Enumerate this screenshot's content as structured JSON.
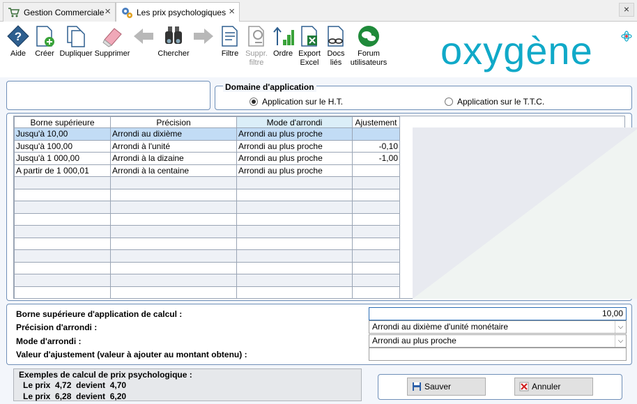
{
  "tabs": [
    {
      "label": "Gestion Commerciale",
      "icon": "cart-icon",
      "active": false
    },
    {
      "label": "Les prix psychologiques",
      "icon": "gears-icon",
      "active": true
    }
  ],
  "toolbar": {
    "aide": "Aide",
    "creer": "Créer",
    "dupliquer": "Dupliquer",
    "supprimer": "Supprimer",
    "chercher": "Chercher",
    "filtre": "Filtre",
    "suppr_filtre": [
      "Suppr.",
      "filtre"
    ],
    "ordre": "Ordre",
    "export_excel": [
      "Export",
      "Excel"
    ],
    "docs_lies": [
      "Docs",
      "liés"
    ],
    "forum": [
      "Forum",
      "utilisateurs"
    ]
  },
  "logo": "oxygène",
  "domain": {
    "legend": "Domaine d'application",
    "ht": "Application sur le H.T.",
    "ttc": "Application sur le T.T.C.",
    "selected": "ht"
  },
  "grid": {
    "columns": [
      "Borne supérieure",
      "Précision",
      "Mode d'arrondi",
      "Ajustement"
    ],
    "rows": [
      [
        "Jusqu'à 10,00",
        "Arrondi au dixième",
        "Arrondi au plus proche",
        ""
      ],
      [
        "Jusqu'à 100,00",
        "Arrondi à l'unité",
        "Arrondi au plus proche",
        "-0,10"
      ],
      [
        "Jusqu'à 1 000,00",
        "Arrondi à la dizaine",
        "Arrondi au plus proche",
        "-1,00"
      ],
      [
        "A partir de 1 000,01",
        "Arrondi à la centaine",
        "Arrondi au plus proche",
        ""
      ]
    ],
    "empty_rows": 10
  },
  "form": {
    "borne_label": "Borne supérieure d'application de calcul :",
    "borne_value": "10,00",
    "precision_label": "Précision d'arrondi :",
    "precision_value": "Arrondi au dixième d'unité monétaire",
    "mode_label": "Mode d'arrondi :",
    "mode_value": "Arrondi au plus proche",
    "ajust_label": "Valeur d'ajustement (valeur à ajouter au montant obtenu) :",
    "ajust_value": ""
  },
  "examples": {
    "title": "Exemples de calcul de prix psychologique :",
    "line1": "Le prix  4,72  devient  4,70",
    "line2": "Le prix  6,28  devient  6,20"
  },
  "buttons": {
    "save": "Sauver",
    "cancel": "Annuler"
  },
  "colors": {
    "accent": "#10a9c8",
    "selection": "#c2dcf5",
    "panel_border": "#6f8fb8"
  }
}
